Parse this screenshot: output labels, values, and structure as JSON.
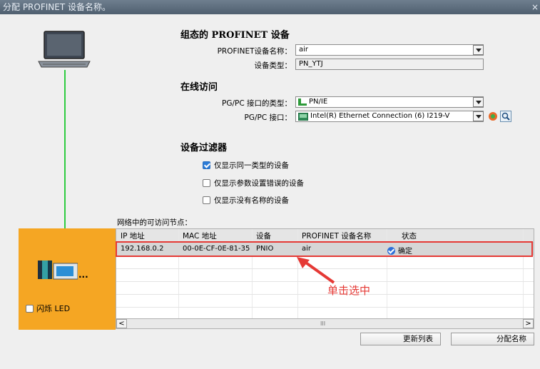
{
  "window": {
    "title": "分配 PROFINET 设备名称。",
    "close_glyph": "×"
  },
  "config": {
    "heading": "组态的 PROFINET 设备",
    "device_name_label": "PROFINET设备名称：",
    "device_name_value": "air",
    "device_type_label": "设备类型：",
    "device_type_value": "PN_YTJ"
  },
  "online": {
    "heading": "在线访问",
    "iface_type_label": "PG/PC 接口的类型：",
    "iface_type_value": "PN/IE",
    "iface_label": "PG/PC 接口：",
    "iface_value": "Intel(R) Ethernet Connection (6) I219-V"
  },
  "filter": {
    "heading": "设备过滤器",
    "options": [
      {
        "label": "仅显示同一类型的设备",
        "checked": true
      },
      {
        "label": "仅显示参数设置错误的设备",
        "checked": false
      },
      {
        "label": "仅显示没有名称的设备",
        "checked": false
      }
    ]
  },
  "nodes": {
    "caption": "网络中的可访问节点：",
    "columns": [
      "IP 地址",
      "MAC 地址",
      "设备",
      "PROFINET 设备名称",
      "状态"
    ],
    "rows": [
      {
        "ip": "192.168.0.2",
        "mac": "00-0E-CF-0E-81-35",
        "device": "PNIO",
        "name": "air",
        "status": "确定"
      }
    ],
    "hint": "单击选中"
  },
  "left": {
    "device_dots": "...",
    "flash_led_label": "闪烁 LED"
  },
  "scroll": {
    "grip": "III",
    "left": "<",
    "right": ">"
  },
  "buttons": {
    "update_list": "更新列表",
    "assign_name": "分配名称"
  },
  "colors": {
    "accent_orange": "#f5a623",
    "link_green": "#2ecc40",
    "highlight_red": "#e53935",
    "status_blue": "#2e6fd8"
  }
}
